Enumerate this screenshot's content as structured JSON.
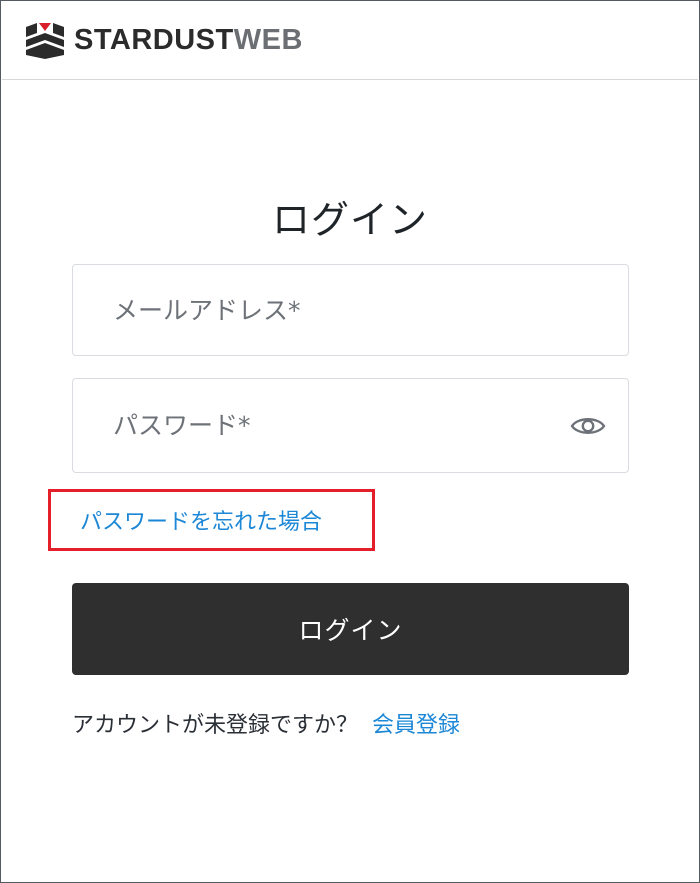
{
  "brand": {
    "name_part1": "STARDUST",
    "name_part2": "WEB",
    "logo_icon": "stardust-logo-icon",
    "colors": {
      "dark": "#2b2b2b",
      "grey": "#6b6e72",
      "accent_red": "#d9202a"
    }
  },
  "login": {
    "title": "ログイン",
    "email_placeholder": "メールアドレス*",
    "password_placeholder": "パスワード*",
    "show_password_icon": "eye-icon",
    "forgot_password_link": "パスワードを忘れた場合",
    "submit_label": "ログイン"
  },
  "signup": {
    "prompt": "アカウントが未登録ですか？",
    "link": "会員登録"
  },
  "theme": {
    "link_color": "#1b87d6",
    "button_bg": "#2f2f2f",
    "highlight_border": "#e41f2a"
  }
}
